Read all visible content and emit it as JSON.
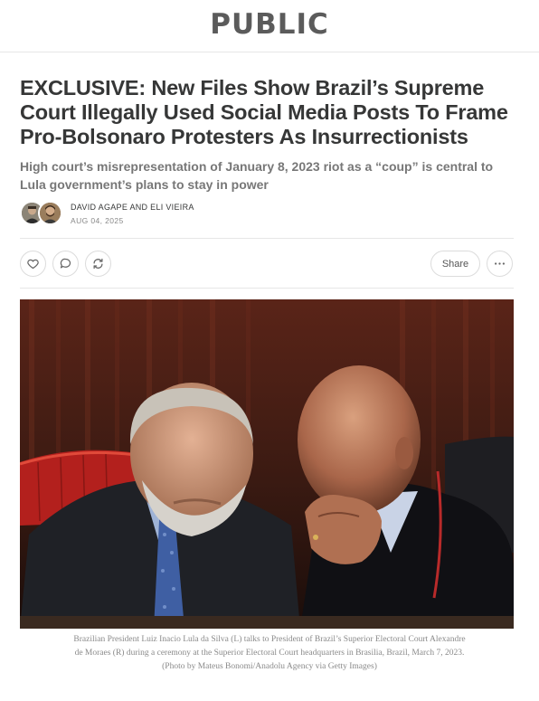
{
  "publication": {
    "name": "PUBLIC"
  },
  "article": {
    "title": "EXCLUSIVE: New Files Show Brazil’s Supreme Court Illegally Used Social Media Posts To Frame Pro-Bolsonaro Protesters As Insurrectionists",
    "subtitle": "High court’s misrepresentation of January 8, 2023 riot as a “coup” is central to Lula government’s plans to stay in power",
    "authors": "DAVID AGAPE AND ELI VIEIRA",
    "date": "AUG 04, 2025"
  },
  "actions": {
    "like_icon": "heart-icon",
    "comment_icon": "comment-icon",
    "restack_icon": "restack-icon",
    "share_label": "Share",
    "more_icon": "ellipsis-icon"
  },
  "image": {
    "caption": "Brazilian President Luiz Inacio Lula da Silva (L) talks to President of Brazil’s Superior Electoral Court Alexandre de Moraes (R) during a ceremony at the Superior Electoral Court headquarters in Brasilia, Brazil, March 7, 2023. (Photo by Mateus Bonomi/Anadolu Agency via Getty Images)"
  },
  "colors": {
    "text": "#363737",
    "muted": "#777777",
    "border": "#e6e6e6",
    "logo": "#5b5b5b"
  }
}
